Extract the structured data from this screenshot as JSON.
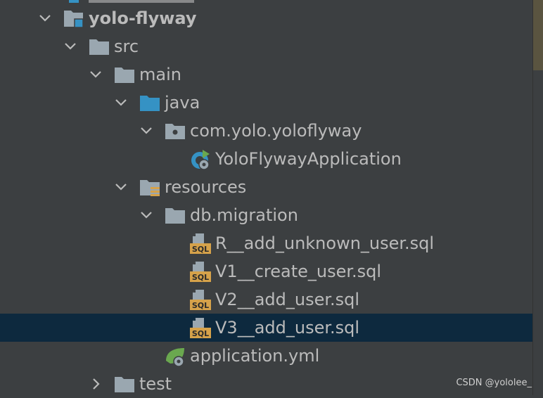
{
  "project_tree": {
    "nodes": [
      {
        "label": "yolo-flyway",
        "expanded": true,
        "icon": "module-folder-icon"
      },
      {
        "label": "src",
        "expanded": true,
        "icon": "folder-icon"
      },
      {
        "label": "main",
        "expanded": true,
        "icon": "folder-icon"
      },
      {
        "label": "java",
        "expanded": true,
        "icon": "source-root-folder-icon"
      },
      {
        "label": "com.yolo.yoloflyway",
        "expanded": true,
        "icon": "package-icon"
      },
      {
        "label": "YoloFlywayApplication",
        "icon": "spring-boot-application-class-icon"
      },
      {
        "label": "resources",
        "expanded": true,
        "icon": "resources-root-folder-icon"
      },
      {
        "label": "db.migration",
        "expanded": true,
        "icon": "folder-icon"
      },
      {
        "label": "R__add_unknown_user.sql",
        "icon": "sql-file-icon"
      },
      {
        "label": "V1__create_user.sql",
        "icon": "sql-file-icon"
      },
      {
        "label": "V2__add_user.sql",
        "icon": "sql-file-icon"
      },
      {
        "label": "V3__add_user.sql",
        "icon": "sql-file-icon",
        "selected": true
      },
      {
        "label": "application.yml",
        "icon": "spring-config-file-icon"
      },
      {
        "label": "test",
        "expanded": false,
        "icon": "folder-icon"
      }
    ]
  },
  "watermark": "CSDN @yololee_",
  "colors": {
    "background": "#3c3f41",
    "selection": "#0d293e",
    "text": "#bbbbbb",
    "folder": "#9aa7b0",
    "source_root": "#3592c4",
    "sql_badge": "#d6a24a",
    "spring_green": "#6aa84f"
  }
}
